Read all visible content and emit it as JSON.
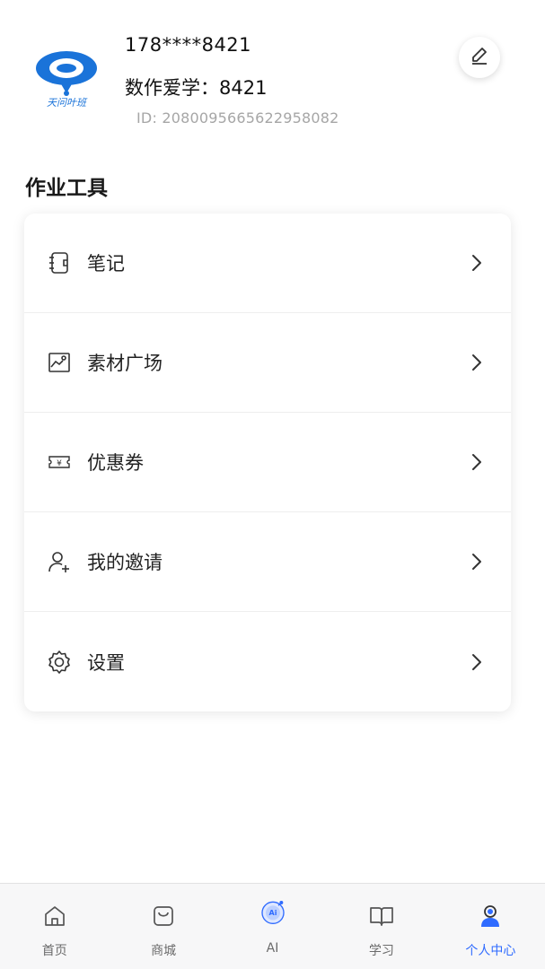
{
  "profile": {
    "logo_text": "天问叶班",
    "phone": "178****8421",
    "nickname": "数作爱学：8421",
    "user_id": "ID: 2080095665622958082"
  },
  "section_title": "作业工具",
  "menu": [
    {
      "label": "笔记",
      "icon": "notebook-icon"
    },
    {
      "label": "素材广场",
      "icon": "image-gallery-icon"
    },
    {
      "label": "优惠券",
      "icon": "coupon-icon"
    },
    {
      "label": "我的邀请",
      "icon": "invite-user-icon"
    },
    {
      "label": "设置",
      "icon": "gear-icon"
    }
  ],
  "tabs": [
    {
      "label": "首页",
      "icon": "home-icon",
      "active": false
    },
    {
      "label": "商城",
      "icon": "shop-bag-icon",
      "active": false
    },
    {
      "label": "AI",
      "icon": "ai-robot-icon",
      "active": false
    },
    {
      "label": "学习",
      "icon": "book-icon",
      "active": false
    },
    {
      "label": "个人中心",
      "icon": "profile-icon",
      "active": true
    }
  ],
  "colors": {
    "accent": "#2f6bff",
    "logo_blue": "#1a73d9"
  }
}
